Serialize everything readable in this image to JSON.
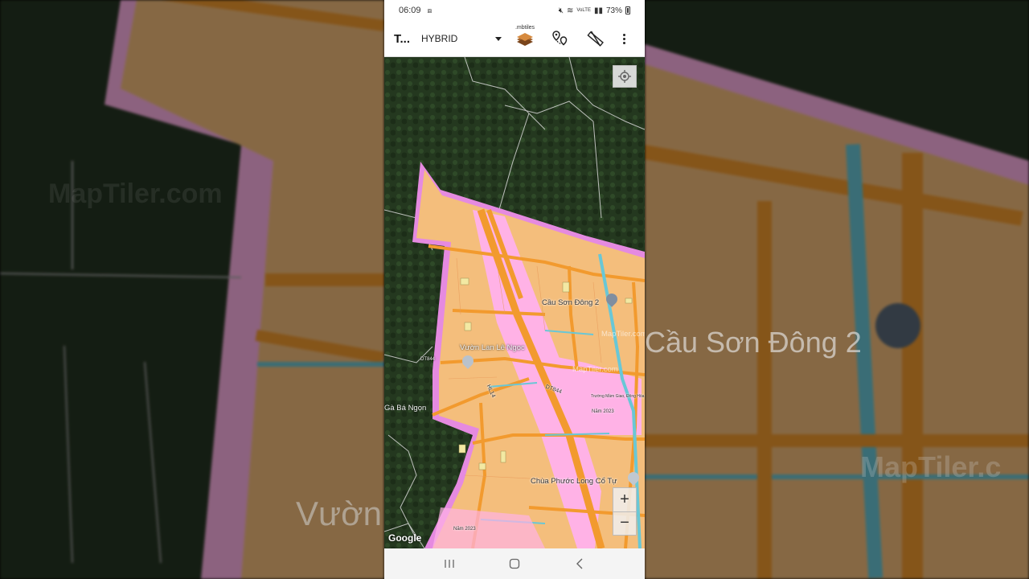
{
  "status": {
    "time": "06:09",
    "battery": "73%",
    "network": "VoLTE"
  },
  "appbar": {
    "title": "T...",
    "map_type": "HYBRID",
    "mbtiles_label": ".mbtiles"
  },
  "map": {
    "labels": {
      "poi1": "Cầu Sơn Đông 2",
      "poi2": "Vườn Lan Lê Ngọc",
      "poi3": "Chùa Phước Long Cổ Tự",
      "place1": "Gà Bá Ngọn",
      "road1": "DT844",
      "road2": "HL14",
      "road3": "DT844",
      "watermark1": "MapTiler.com",
      "watermark2": "MapTiler.com",
      "school": "Trường Mầm Giao, Đông Hòa",
      "year1": "Năm 2023",
      "year2": "Năm 2023"
    },
    "attribution": "Google",
    "zoom_in": "+",
    "zoom_out": "−"
  },
  "background": {
    "right_label": "Cầu Sơn Đông 2",
    "right_watermark": "MapTiler.c",
    "left_label": "Vườn",
    "left_watermark": "MapTiler.com"
  },
  "colors": {
    "parcel": "#f4be7c",
    "pink_zone": "#ffb2e6",
    "boundary": "#e58ae0",
    "road": "#f29a2e",
    "canal": "#69c7d6",
    "satellite": "#25381f"
  }
}
